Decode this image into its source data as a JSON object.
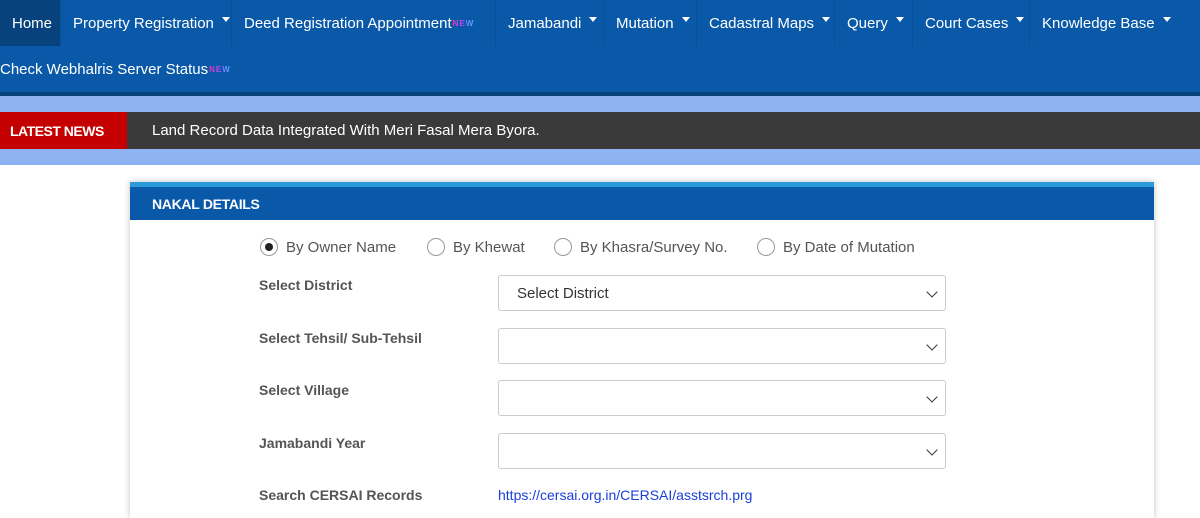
{
  "nav": {
    "row1": [
      {
        "label": "Home",
        "active": true,
        "caret": false
      },
      {
        "label": "Property Registration",
        "caret": true
      },
      {
        "label": "Deed Registration Appointment",
        "badge": "NEW",
        "caret": false
      },
      {
        "label": "Jamabandi",
        "caret": true
      },
      {
        "label": "Mutation",
        "caret": true
      },
      {
        "label": "Cadastral Maps",
        "caret": true
      },
      {
        "label": "Query",
        "caret": true
      },
      {
        "label": "Court Cases",
        "caret": true
      },
      {
        "label": "Knowledge Base",
        "caret": true
      }
    ],
    "row2": [
      {
        "label": "Check Webhalris Server Status",
        "badge": "NEW"
      }
    ]
  },
  "news": {
    "label": "LATEST NEWS",
    "text": "Land Record Data Integrated With Meri Fasal Mera Byora."
  },
  "panel": {
    "title": "NAKAL DETAILS",
    "radios": [
      {
        "label": "By Owner Name",
        "checked": true
      },
      {
        "label": "By Khewat",
        "checked": false
      },
      {
        "label": "By Khasra/Survey No.",
        "checked": false
      },
      {
        "label": "By Date of Mutation",
        "checked": false
      }
    ],
    "fields": [
      {
        "label": "Select District",
        "value": "Select District"
      },
      {
        "label": "Select Tehsil/ Sub-Tehsil",
        "value": ""
      },
      {
        "label": "Select Village",
        "value": ""
      },
      {
        "label": "Jamabandi Year",
        "value": ""
      }
    ],
    "cersai": {
      "label": "Search CERSAI Records",
      "link": "https://cersai.org.in/CERSAI/asstsrch.prg"
    }
  },
  "colors": {
    "nav_bg": "#0a59a8",
    "band": "#8fb3f2",
    "news_label_bg": "#c40000",
    "news_bg": "#3a3a3a",
    "link": "#1a3fd8"
  }
}
